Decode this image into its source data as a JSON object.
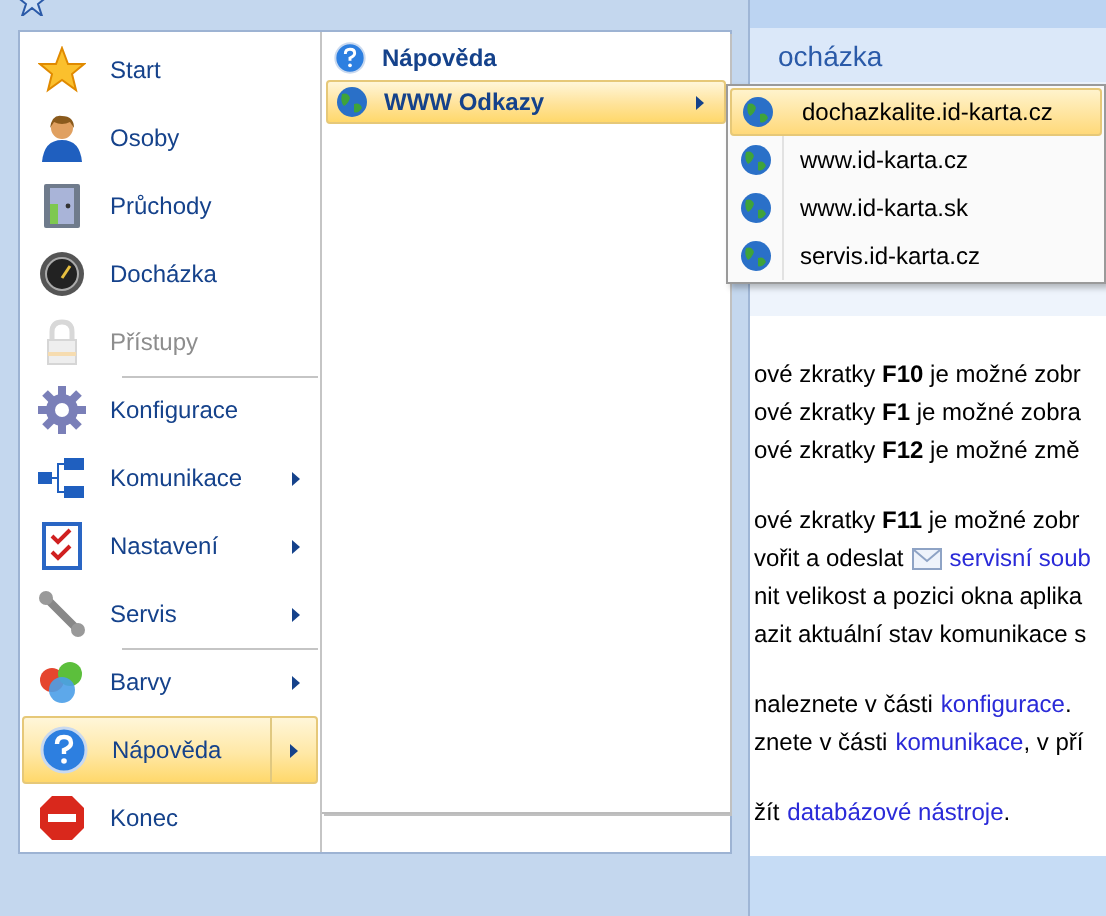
{
  "background": {
    "section_title": "ocházka",
    "paragraphs": [
      {
        "lines": [
          {
            "parts": [
              {
                "kind": "text",
                "text": "ové zkratky **F10** je možné zobr"
              }
            ]
          },
          {
            "parts": [
              {
                "kind": "text",
                "text": "ové zkratky **F1** je možné zobra"
              }
            ]
          },
          {
            "parts": [
              {
                "kind": "text",
                "text": "ové zkratky **F12** je možné změ"
              }
            ]
          }
        ]
      },
      {
        "lines": [
          {
            "parts": [
              {
                "kind": "text",
                "text": "ové zkratky **F11** je možné zobr"
              }
            ]
          },
          {
            "parts": [
              {
                "kind": "text",
                "text": "vořit a odeslat"
              },
              {
                "kind": "mail"
              },
              {
                "kind": "link",
                "text": "servisní soub"
              }
            ]
          },
          {
            "parts": [
              {
                "kind": "text",
                "text": "nit velikost a pozici okna aplika"
              }
            ]
          },
          {
            "parts": [
              {
                "kind": "text",
                "text": "azit aktuální stav komunikace s"
              }
            ]
          }
        ]
      },
      {
        "lines": [
          {
            "parts": [
              {
                "kind": "text",
                "text": "naleznete v části"
              },
              {
                "kind": "link",
                "text": "konfigurace"
              },
              {
                "kind": "tail",
                "text": "."
              }
            ]
          },
          {
            "parts": [
              {
                "kind": "text",
                "text": "znete v části"
              },
              {
                "kind": "link",
                "text": "komunikace"
              },
              {
                "kind": "tail",
                "text": ", v pří"
              }
            ]
          }
        ]
      },
      {
        "lines": [
          {
            "parts": [
              {
                "kind": "text",
                "text": "žít"
              },
              {
                "kind": "link",
                "text": "databázové nástroje"
              },
              {
                "kind": "tail",
                "text": "."
              }
            ]
          }
        ]
      }
    ]
  },
  "menu": {
    "items": [
      {
        "label": "Start",
        "disabled": false,
        "selected": false,
        "submenu": false,
        "separator_before": false
      },
      {
        "label": "Osoby",
        "disabled": false,
        "selected": false,
        "submenu": false,
        "separator_before": false
      },
      {
        "label": "Průchody",
        "disabled": false,
        "selected": false,
        "submenu": false,
        "separator_before": false
      },
      {
        "label": "Docházka",
        "disabled": false,
        "selected": false,
        "submenu": false,
        "separator_before": false
      },
      {
        "label": "Přístupy",
        "disabled": true,
        "selected": false,
        "submenu": false,
        "separator_before": false
      },
      {
        "label": "Konfigurace",
        "disabled": false,
        "selected": false,
        "submenu": false,
        "separator_before": true
      },
      {
        "label": "Komunikace",
        "disabled": false,
        "selected": false,
        "submenu": true,
        "separator_before": false
      },
      {
        "label": "Nastavení",
        "disabled": false,
        "selected": false,
        "submenu": true,
        "separator_before": false
      },
      {
        "label": "Servis",
        "disabled": false,
        "selected": false,
        "submenu": true,
        "separator_before": false
      },
      {
        "label": "Barvy",
        "disabled": false,
        "selected": false,
        "submenu": true,
        "separator_before": true
      },
      {
        "label": "Nápověda",
        "disabled": false,
        "selected": true,
        "submenu": true,
        "separator_before": false
      },
      {
        "label": "Konec",
        "disabled": false,
        "selected": false,
        "submenu": false,
        "separator_before": false
      }
    ]
  },
  "help_panel": {
    "title": "Nápověda",
    "items": [
      {
        "label": "WWW Odkazy",
        "selected": true,
        "submenu": true
      }
    ]
  },
  "links_submenu": {
    "items": [
      {
        "label": "dochazkalite.id-karta.cz",
        "selected": true
      },
      {
        "label": "www.id-karta.cz",
        "selected": false
      },
      {
        "label": "www.id-karta.sk",
        "selected": false
      },
      {
        "label": "servis.id-karta.cz",
        "selected": false
      }
    ]
  }
}
